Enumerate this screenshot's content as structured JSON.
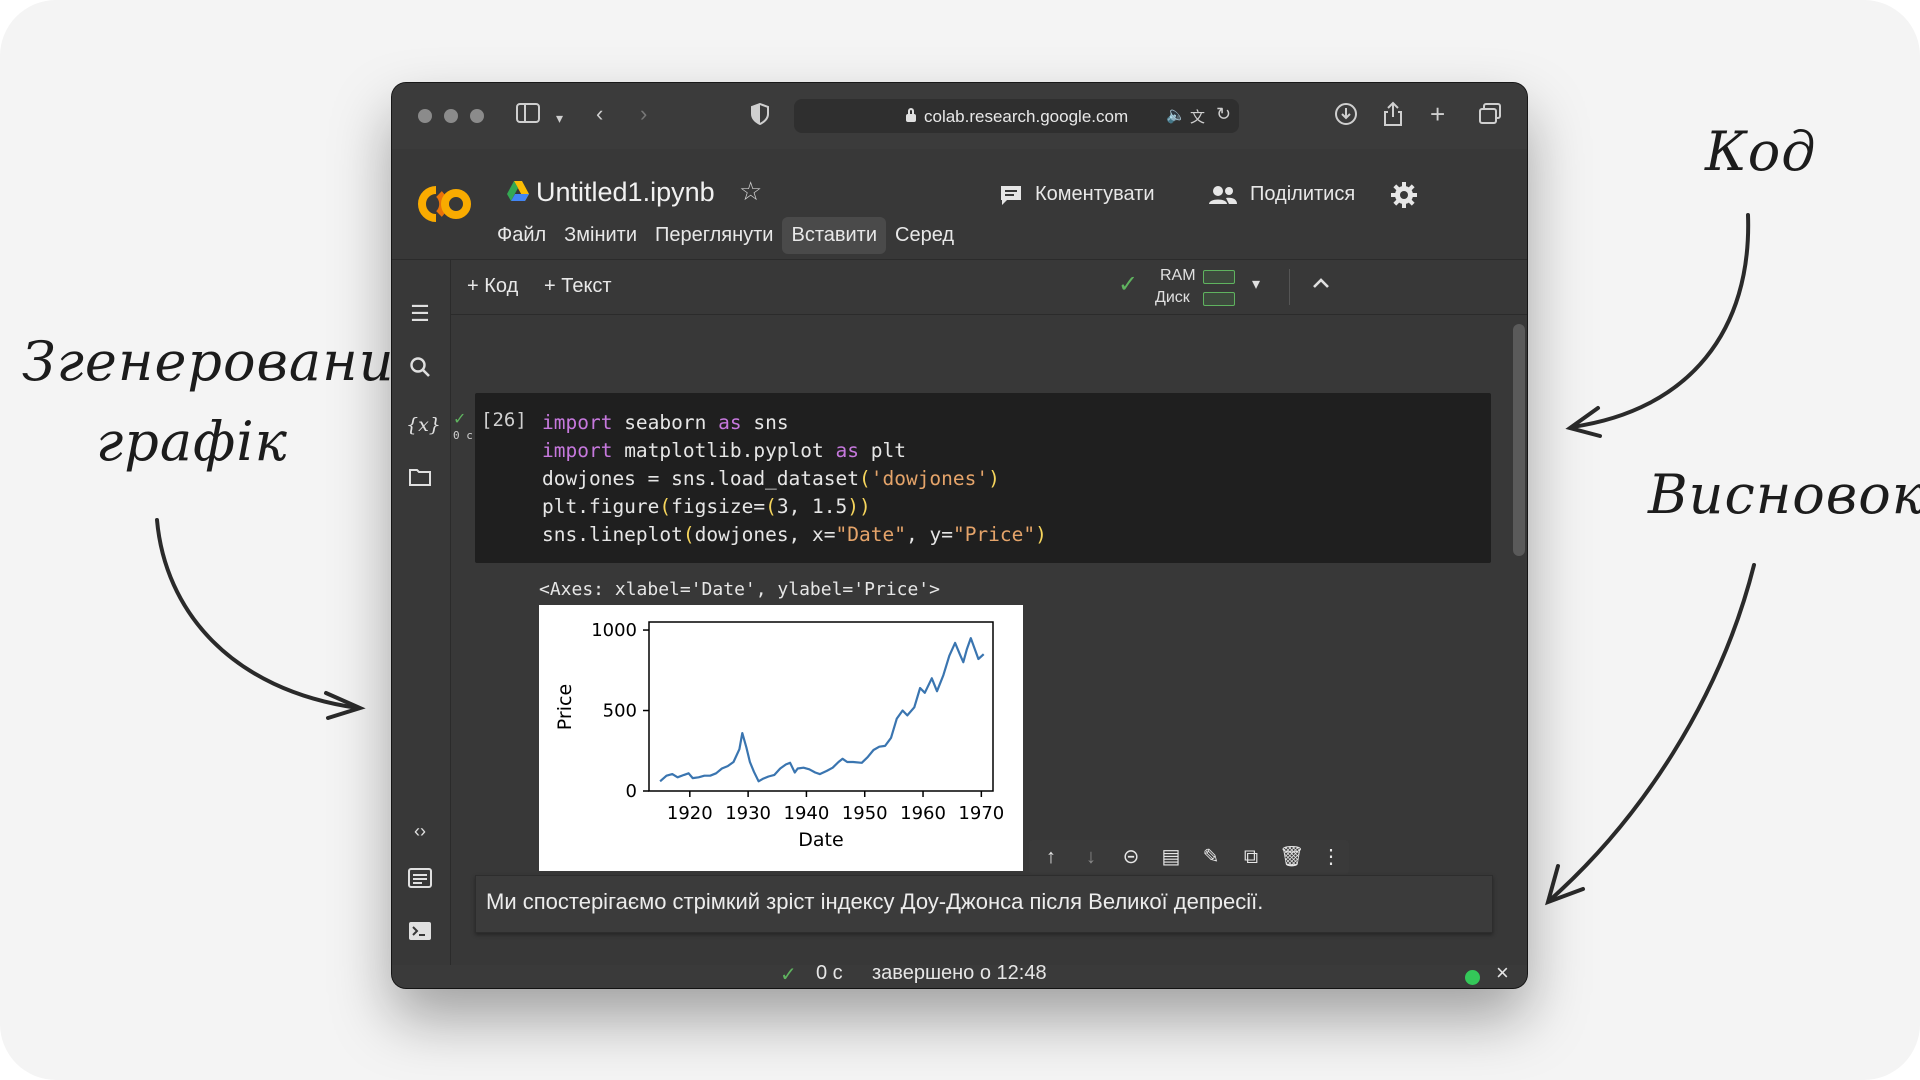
{
  "annotations": {
    "code": "Код",
    "generated_line1": "Згенерований",
    "generated_line2": "графік",
    "conclusion": "Висновок"
  },
  "browser": {
    "url": "colab.research.google.com"
  },
  "notebook": {
    "title": "Untitled1.ipynb",
    "menu": [
      "Файл",
      "Змінити",
      "Переглянути",
      "Вставити",
      "Серед"
    ],
    "active_menu": "Вставити",
    "comment_label": "Коментувати",
    "share_label": "Поділитися"
  },
  "toolbar": {
    "add_code": "+ Код",
    "add_text": "+ Текст",
    "ram_label": "RAM",
    "disk_label": "Диск"
  },
  "code_cell": {
    "exec_count": "[26]",
    "exec_time": "0 с",
    "lines": [
      "import seaborn as sns",
      "import matplotlib.pyplot as plt",
      "dowjones = sns.load_dataset('dowjones')",
      "plt.figure(figsize=(3, 1.5))",
      "sns.lineplot(dowjones, x=\"Date\", y=\"Price\")"
    ],
    "output_repr": "<Axes: xlabel='Date', ylabel='Price'>"
  },
  "chart_data": {
    "type": "line",
    "title": "",
    "xlabel": "Date",
    "ylabel": "Price",
    "xlim": [
      1913,
      1972
    ],
    "ylim": [
      0,
      1050
    ],
    "x_ticks": [
      1920,
      1930,
      1940,
      1950,
      1960,
      1970
    ],
    "y_ticks": [
      0,
      500,
      1000
    ],
    "line_color": "#3a75b0",
    "grid": false,
    "x": [
      1914.9,
      1916,
      1917,
      1917.9,
      1919,
      1919.8,
      1920.5,
      1921.5,
      1922.5,
      1923.5,
      1924.5,
      1925.5,
      1926.5,
      1927.5,
      1928.5,
      1929.0,
      1929.7,
      1930.3,
      1931,
      1931.8,
      1932.5,
      1933.5,
      1934.5,
      1935.5,
      1936.5,
      1937.2,
      1938,
      1938.5,
      1939.5,
      1940.5,
      1941.5,
      1942.3,
      1943.5,
      1944.5,
      1945.5,
      1946.2,
      1947,
      1948,
      1949.5,
      1950.5,
      1951.5,
      1952.5,
      1953.5,
      1954.5,
      1955.5,
      1956.5,
      1957.3,
      1958.5,
      1959.5,
      1960.3,
      1961.5,
      1962.4,
      1963.5,
      1964.5,
      1965.5,
      1966.3,
      1966.9,
      1967.5,
      1968.2,
      1968.9,
      1969.5,
      1970.4
    ],
    "values": [
      60,
      95,
      105,
      85,
      100,
      110,
      80,
      85,
      95,
      95,
      110,
      140,
      155,
      180,
      260,
      360,
      270,
      180,
      120,
      60,
      75,
      90,
      100,
      140,
      165,
      175,
      115,
      140,
      145,
      135,
      115,
      105,
      125,
      145,
      180,
      200,
      180,
      180,
      175,
      210,
      255,
      275,
      280,
      330,
      450,
      500,
      470,
      520,
      640,
      610,
      700,
      620,
      720,
      840,
      920,
      850,
      800,
      880,
      950,
      880,
      820,
      850
    ]
  },
  "text_cell": {
    "content": "Ми спостерігаємо стрімкий зріст індексу Доу-Джонса після Великої депресії."
  },
  "status": {
    "elapsed": "0 с",
    "completed": "завершено о 12:48"
  },
  "colors": {
    "accent_green": "#5fb35f",
    "colab_orange": "#f9ab00",
    "status_dot": "#34c759"
  }
}
